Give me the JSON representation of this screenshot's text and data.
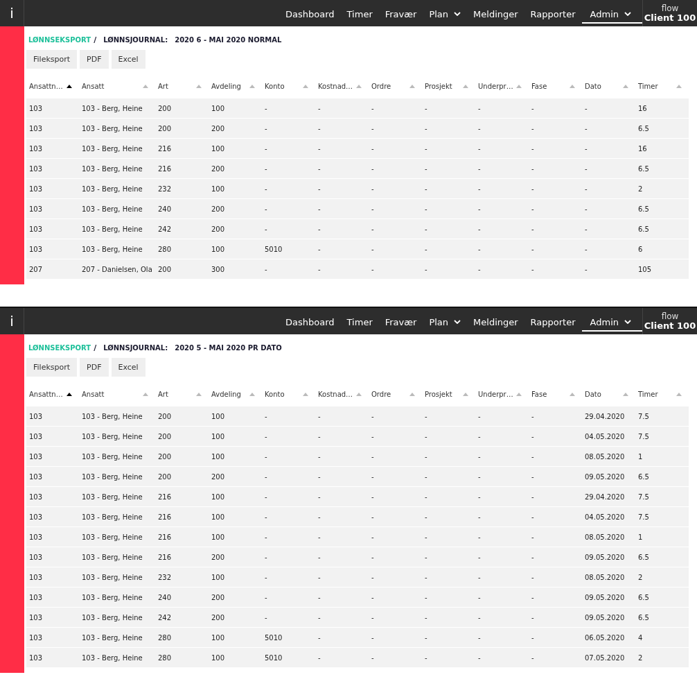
{
  "panels": [
    {
      "nav": {
        "info": "i",
        "items": [
          {
            "label": "Dashboard",
            "dropdown": false,
            "selected": false
          },
          {
            "label": "Timer",
            "dropdown": false,
            "selected": false
          },
          {
            "label": "Fravær",
            "dropdown": false,
            "selected": false
          },
          {
            "label": "Plan",
            "dropdown": true,
            "selected": false
          },
          {
            "label": "Meldinger",
            "dropdown": false,
            "selected": false
          },
          {
            "label": "Rapporter",
            "dropdown": false,
            "selected": false
          },
          {
            "label": "Admin",
            "dropdown": true,
            "selected": true
          }
        ],
        "brand": "flow",
        "client": "Client 100"
      },
      "breadcrumb": {
        "link": "LØNNSEKSPORT",
        "separator": "/",
        "label": "LØNNSJOURNAL:",
        "value": "2020 6 - MAI 2020 NORMAL"
      },
      "buttons": [
        "Fileksport",
        "PDF",
        "Excel"
      ],
      "columns": [
        {
          "label": "Ansattn…",
          "sorted": true
        },
        {
          "label": "Ansatt",
          "sorted": false
        },
        {
          "label": "Art",
          "sorted": false
        },
        {
          "label": "Avdeling",
          "sorted": false
        },
        {
          "label": "Konto",
          "sorted": false
        },
        {
          "label": "Kostnad…",
          "sorted": false
        },
        {
          "label": "Ordre",
          "sorted": false
        },
        {
          "label": "Prosjekt",
          "sorted": false
        },
        {
          "label": "Underpr…",
          "sorted": false
        },
        {
          "label": "Fase",
          "sorted": false
        },
        {
          "label": "Dato",
          "sorted": false
        },
        {
          "label": "Timer",
          "sorted": false
        }
      ],
      "rows": [
        [
          "103",
          "103 - Berg, Heine",
          "200",
          "100",
          "-",
          "-",
          "-",
          "-",
          "-",
          "-",
          "-",
          "16"
        ],
        [
          "103",
          "103 - Berg, Heine",
          "200",
          "200",
          "-",
          "-",
          "-",
          "-",
          "-",
          "-",
          "-",
          "6.5"
        ],
        [
          "103",
          "103 - Berg, Heine",
          "216",
          "100",
          "-",
          "-",
          "-",
          "-",
          "-",
          "-",
          "-",
          "16"
        ],
        [
          "103",
          "103 - Berg, Heine",
          "216",
          "200",
          "-",
          "-",
          "-",
          "-",
          "-",
          "-",
          "-",
          "6.5"
        ],
        [
          "103",
          "103 - Berg, Heine",
          "232",
          "100",
          "-",
          "-",
          "-",
          "-",
          "-",
          "-",
          "-",
          "2"
        ],
        [
          "103",
          "103 - Berg, Heine",
          "240",
          "200",
          "-",
          "-",
          "-",
          "-",
          "-",
          "-",
          "-",
          "6.5"
        ],
        [
          "103",
          "103 - Berg, Heine",
          "242",
          "200",
          "-",
          "-",
          "-",
          "-",
          "-",
          "-",
          "-",
          "6.5"
        ],
        [
          "103",
          "103 - Berg, Heine",
          "280",
          "100",
          "5010",
          "-",
          "-",
          "-",
          "-",
          "-",
          "-",
          "6"
        ],
        [
          "207",
          "207 - Danielsen, Ola",
          "200",
          "300",
          "-",
          "-",
          "-",
          "-",
          "-",
          "-",
          "-",
          "105"
        ]
      ]
    },
    {
      "nav": {
        "info": "i",
        "items": [
          {
            "label": "Dashboard",
            "dropdown": false,
            "selected": false
          },
          {
            "label": "Timer",
            "dropdown": false,
            "selected": false
          },
          {
            "label": "Fravær",
            "dropdown": false,
            "selected": false
          },
          {
            "label": "Plan",
            "dropdown": true,
            "selected": false
          },
          {
            "label": "Meldinger",
            "dropdown": false,
            "selected": false
          },
          {
            "label": "Rapporter",
            "dropdown": false,
            "selected": false
          },
          {
            "label": "Admin",
            "dropdown": true,
            "selected": true
          }
        ],
        "brand": "flow",
        "client": "Client 100"
      },
      "breadcrumb": {
        "link": "LØNNSEKSPORT",
        "separator": "/",
        "label": "LØNNSJOURNAL:",
        "value": "2020 5 - MAI 2020 PR DATO"
      },
      "buttons": [
        "Fileksport",
        "PDF",
        "Excel"
      ],
      "columns": [
        {
          "label": "Ansattn…",
          "sorted": true
        },
        {
          "label": "Ansatt",
          "sorted": false
        },
        {
          "label": "Art",
          "sorted": false
        },
        {
          "label": "Avdeling",
          "sorted": false
        },
        {
          "label": "Konto",
          "sorted": false
        },
        {
          "label": "Kostnad…",
          "sorted": false
        },
        {
          "label": "Ordre",
          "sorted": false
        },
        {
          "label": "Prosjekt",
          "sorted": false
        },
        {
          "label": "Underpr…",
          "sorted": false
        },
        {
          "label": "Fase",
          "sorted": false
        },
        {
          "label": "Dato",
          "sorted": false
        },
        {
          "label": "Timer",
          "sorted": false
        }
      ],
      "rows": [
        [
          "103",
          "103 - Berg, Heine",
          "200",
          "100",
          "-",
          "-",
          "-",
          "-",
          "-",
          "-",
          "29.04.2020",
          "7.5"
        ],
        [
          "103",
          "103 - Berg, Heine",
          "200",
          "100",
          "-",
          "-",
          "-",
          "-",
          "-",
          "-",
          "04.05.2020",
          "7.5"
        ],
        [
          "103",
          "103 - Berg, Heine",
          "200",
          "100",
          "-",
          "-",
          "-",
          "-",
          "-",
          "-",
          "08.05.2020",
          "1"
        ],
        [
          "103",
          "103 - Berg, Heine",
          "200",
          "200",
          "-",
          "-",
          "-",
          "-",
          "-",
          "-",
          "09.05.2020",
          "6.5"
        ],
        [
          "103",
          "103 - Berg, Heine",
          "216",
          "100",
          "-",
          "-",
          "-",
          "-",
          "-",
          "-",
          "29.04.2020",
          "7.5"
        ],
        [
          "103",
          "103 - Berg, Heine",
          "216",
          "100",
          "-",
          "-",
          "-",
          "-",
          "-",
          "-",
          "04.05.2020",
          "7.5"
        ],
        [
          "103",
          "103 - Berg, Heine",
          "216",
          "100",
          "-",
          "-",
          "-",
          "-",
          "-",
          "-",
          "08.05.2020",
          "1"
        ],
        [
          "103",
          "103 - Berg, Heine",
          "216",
          "200",
          "-",
          "-",
          "-",
          "-",
          "-",
          "-",
          "09.05.2020",
          "6.5"
        ],
        [
          "103",
          "103 - Berg, Heine",
          "232",
          "100",
          "-",
          "-",
          "-",
          "-",
          "-",
          "-",
          "08.05.2020",
          "2"
        ],
        [
          "103",
          "103 - Berg, Heine",
          "240",
          "200",
          "-",
          "-",
          "-",
          "-",
          "-",
          "-",
          "09.05.2020",
          "6.5"
        ],
        [
          "103",
          "103 - Berg, Heine",
          "242",
          "200",
          "-",
          "-",
          "-",
          "-",
          "-",
          "-",
          "09.05.2020",
          "6.5"
        ],
        [
          "103",
          "103 - Berg, Heine",
          "280",
          "100",
          "5010",
          "-",
          "-",
          "-",
          "-",
          "-",
          "06.05.2020",
          "4"
        ],
        [
          "103",
          "103 - Berg, Heine",
          "280",
          "100",
          "5010",
          "-",
          "-",
          "-",
          "-",
          "-",
          "07.05.2020",
          "2"
        ]
      ]
    }
  ]
}
